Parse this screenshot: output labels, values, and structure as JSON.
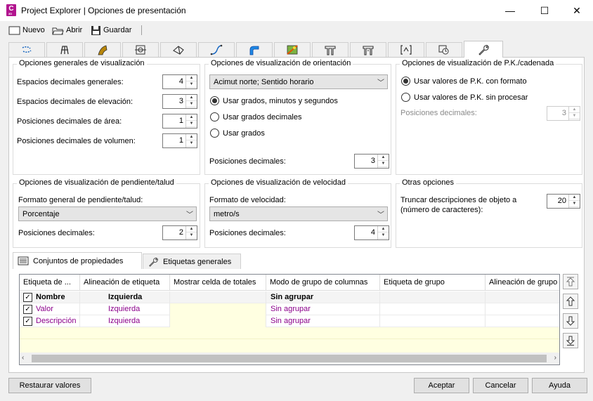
{
  "window": {
    "title": "Project Explorer | Opciones de presentación",
    "app_icon_letter": "C",
    "app_icon_sub": "3D",
    "controls": {
      "minimize": "—",
      "maximize": "☐",
      "close": "✕"
    }
  },
  "toolbar": {
    "new_label": "Nuevo",
    "open_label": "Abrir",
    "save_label": "Guardar"
  },
  "tabs": [
    {
      "icon": "alignment-icon"
    },
    {
      "icon": "parcel-icon"
    },
    {
      "icon": "corridor-icon"
    },
    {
      "icon": "pipe-network-icon"
    },
    {
      "icon": "surface-icon"
    },
    {
      "icon": "profile-icon"
    },
    {
      "icon": "assembly-icon"
    },
    {
      "icon": "grading-icon"
    },
    {
      "icon": "structure-icon"
    },
    {
      "icon": "bridge-icon"
    },
    {
      "icon": "section-icon"
    },
    {
      "icon": "display-icon"
    },
    {
      "icon": "wrench-icon",
      "active": true
    }
  ],
  "general": {
    "title": "Opciones generales de visualización",
    "rows": [
      {
        "label": "Espacios decimales generales:",
        "value": "4"
      },
      {
        "label": "Espacios decimales de elevación:",
        "value": "3"
      },
      {
        "label": "Posiciones decimales de área:",
        "value": "1"
      },
      {
        "label": "Posiciones decimales de volumen:",
        "value": "1"
      }
    ]
  },
  "orientation": {
    "title": "Opciones de visualización de orientación",
    "select_value": "Acimut norte; Sentido horario",
    "radios": [
      "Usar grados, minutos y segundos",
      "Usar grados decimales",
      "Usar grados"
    ],
    "selected_index": 0,
    "decimals_label": "Posiciones decimales:",
    "decimals_value": "3"
  },
  "station": {
    "title": "Opciones de visualización de P.K./cadenada",
    "radios": [
      "Usar valores de P.K. con formato",
      "Usar valores de P.K. sin procesar"
    ],
    "selected_index": 0,
    "decimals_label": "Posiciones decimales:",
    "decimals_value": "3"
  },
  "slope": {
    "title": "Opciones de visualización de pendiente/talud",
    "format_label": "Formato general de pendiente/talud:",
    "select_value": "Porcentaje",
    "decimals_label": "Posiciones decimales:",
    "decimals_value": "2"
  },
  "speed": {
    "title": "Opciones de visualización de velocidad",
    "format_label": "Formato de velocidad:",
    "select_value": "metro/s",
    "decimals_label": "Posiciones decimales:",
    "decimals_value": "4"
  },
  "other": {
    "title": "Otras opciones",
    "truncate_label_1": "Truncar descripciones de objeto a",
    "truncate_label_2": "(número de caracteres):",
    "truncate_value": "20"
  },
  "subtabs": {
    "property_sets": "Conjuntos de propiedades",
    "general_labels": "Etiquetas generales"
  },
  "grid": {
    "headers": [
      "Etiqueta de ...",
      "Alineación de etiqueta",
      "Mostrar celda de totales",
      "Modo de grupo de columnas",
      "Etiqueta de grupo",
      "Alineación de grupo"
    ],
    "rows": [
      {
        "label": "Nombre",
        "align": "Izquierda",
        "totals": "",
        "group_mode": "Sin agrupar",
        "group_label": "",
        "group_align": "",
        "checked": true,
        "highlight": false
      },
      {
        "label": "Valor",
        "align": "Izquierda",
        "totals": "",
        "group_mode": "Sin agrupar",
        "group_label": "",
        "group_align": "",
        "checked": true,
        "highlight": true
      },
      {
        "label": "Descripción",
        "align": "Izquierda",
        "totals": "",
        "group_mode": "Sin agrupar",
        "group_label": "",
        "group_align": "",
        "checked": true,
        "highlight": true
      }
    ],
    "colors": {
      "purple": "#8b008b",
      "yellow": "#ffffe1"
    }
  },
  "side_buttons": [
    "move-top-icon",
    "move-up-icon",
    "move-down-icon",
    "move-bottom-icon"
  ],
  "buttons": {
    "restore": "Restaurar valores",
    "accept": "Aceptar",
    "cancel": "Cancelar",
    "help": "Ayuda"
  }
}
